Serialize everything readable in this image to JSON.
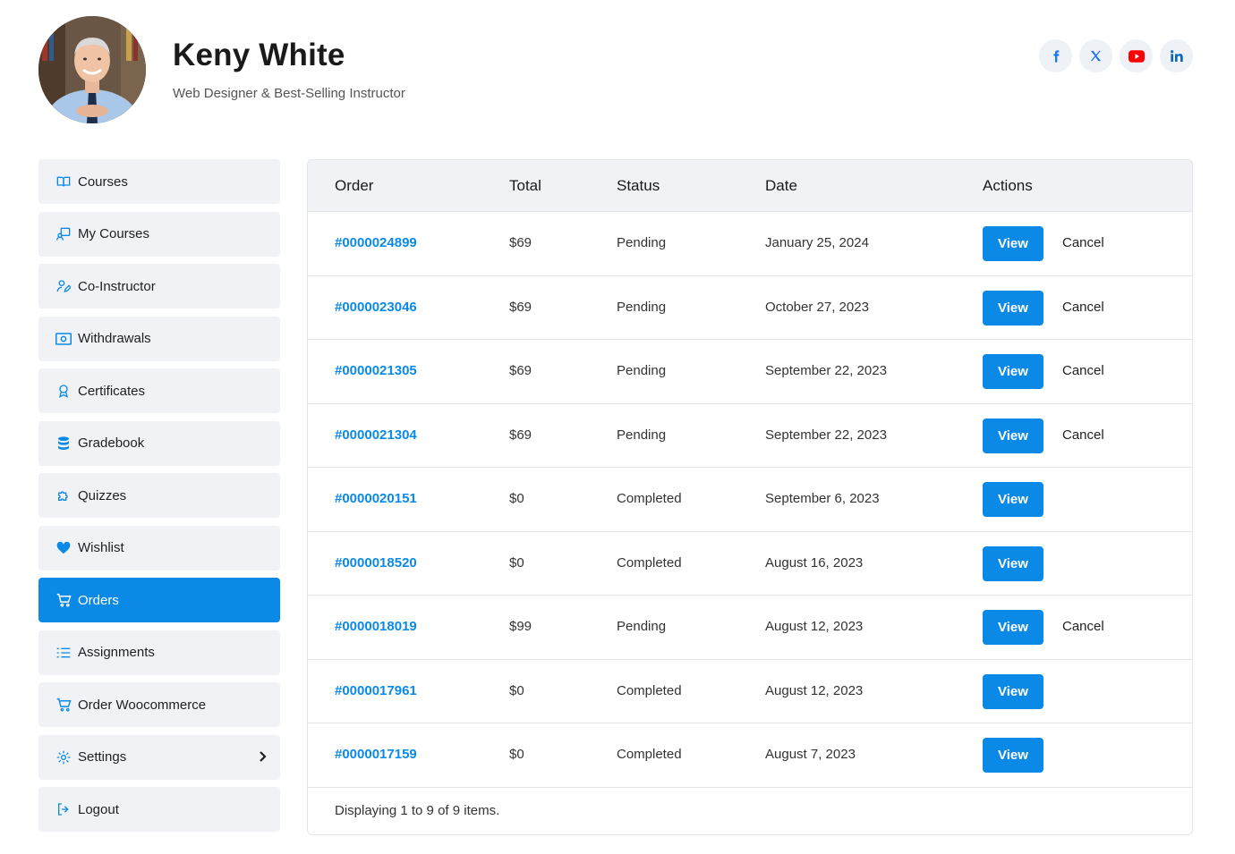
{
  "profile": {
    "name": "Keny White",
    "subtitle": "Web Designer & Best-Selling Instructor"
  },
  "socials": [
    {
      "icon": "facebook-icon",
      "color": "#1877f2"
    },
    {
      "icon": "x-icon",
      "color": "#1d6ff2"
    },
    {
      "icon": "youtube-icon",
      "color": "#ff0000"
    },
    {
      "icon": "linkedin-icon",
      "color": "#0a66c2"
    }
  ],
  "sidebar": {
    "items": [
      {
        "label": "Courses",
        "icon": "book-open-icon"
      },
      {
        "label": "My Courses",
        "icon": "my-courses-icon"
      },
      {
        "label": "Co-Instructor",
        "icon": "user-edit-icon"
      },
      {
        "label": "Withdrawals",
        "icon": "money-icon"
      },
      {
        "label": "Certificates",
        "icon": "award-icon"
      },
      {
        "label": "Gradebook",
        "icon": "database-icon"
      },
      {
        "label": "Quizzes",
        "icon": "puzzle-icon"
      },
      {
        "label": "Wishlist",
        "icon": "heart-icon"
      },
      {
        "label": "Orders",
        "icon": "cart-icon",
        "active": true
      },
      {
        "label": "Assignments",
        "icon": "list-icon"
      },
      {
        "label": "Order Woocommerce",
        "icon": "cart-icon"
      },
      {
        "label": "Settings",
        "icon": "gear-icon",
        "has_chevron": true
      },
      {
        "label": "Logout",
        "icon": "logout-icon"
      }
    ]
  },
  "table": {
    "headers": [
      "Order",
      "Total",
      "Status",
      "Date",
      "Actions"
    ],
    "view_label": "View",
    "cancel_label": "Cancel",
    "rows": [
      {
        "order": "#0000024899",
        "total": "$69",
        "status": "Pending",
        "date": "January 25, 2024",
        "cancel": true
      },
      {
        "order": "#0000023046",
        "total": "$69",
        "status": "Pending",
        "date": "October 27, 2023",
        "cancel": true
      },
      {
        "order": "#0000021305",
        "total": "$69",
        "status": "Pending",
        "date": "September 22, 2023",
        "cancel": true
      },
      {
        "order": "#0000021304",
        "total": "$69",
        "status": "Pending",
        "date": "September 22, 2023",
        "cancel": true
      },
      {
        "order": "#0000020151",
        "total": "$0",
        "status": "Completed",
        "date": "September 6, 2023",
        "cancel": false
      },
      {
        "order": "#0000018520",
        "total": "$0",
        "status": "Completed",
        "date": "August 16, 2023",
        "cancel": false
      },
      {
        "order": "#0000018019",
        "total": "$99",
        "status": "Pending",
        "date": "August 12, 2023",
        "cancel": true
      },
      {
        "order": "#0000017961",
        "total": "$0",
        "status": "Completed",
        "date": "August 12, 2023",
        "cancel": false
      },
      {
        "order": "#0000017159",
        "total": "$0",
        "status": "Completed",
        "date": "August 7, 2023",
        "cancel": false
      }
    ],
    "footer": "Displaying 1 to 9 of 9 items."
  },
  "colors": {
    "accent": "#0a8ae6",
    "sidebar_bg": "#f0f2f6"
  }
}
